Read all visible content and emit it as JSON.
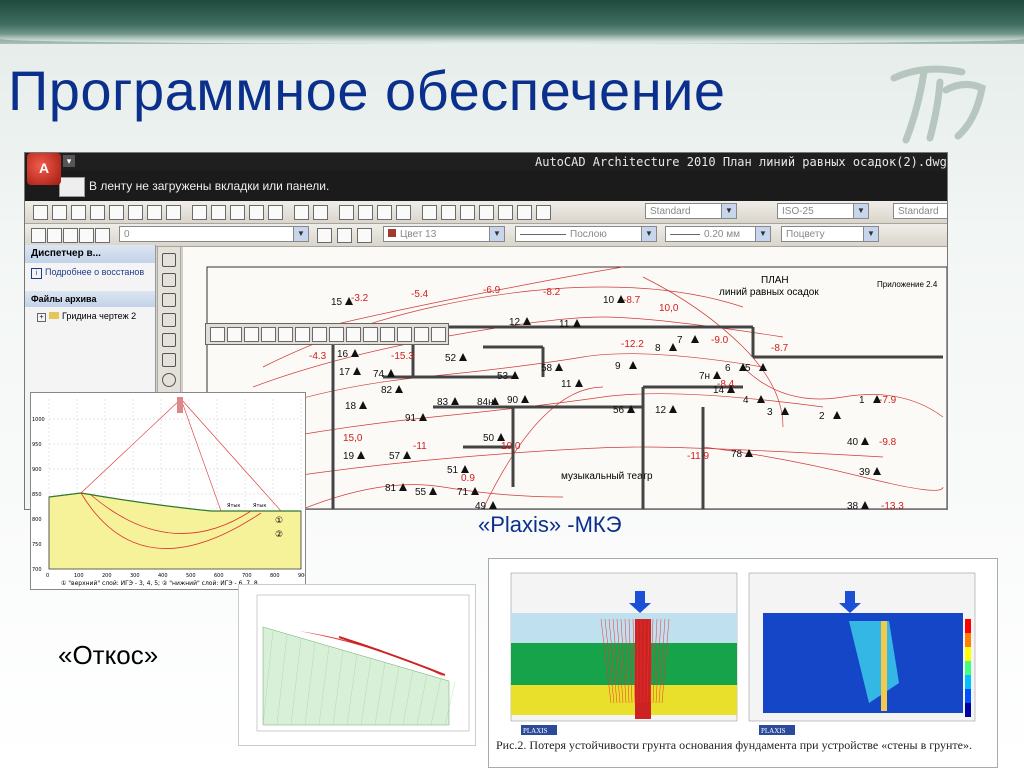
{
  "slide": {
    "title": "Программное обеспечение",
    "caption_plaxis": "«Plaxis» -МКЭ",
    "caption_otkos": "«Откос»",
    "accent": "#0b2f8c"
  },
  "autocad": {
    "window_title": "AutoCAD Architecture 2010    План линий равных осадок(2).dwg",
    "app_button": "A",
    "ribbon_message": "В ленту не загружены вкладки или панели.",
    "toolbar": {
      "combo_text_style": "Standard",
      "combo_dim_style": "ISO-25",
      "combo_table_style": "Standard"
    },
    "props": {
      "layer": "0",
      "color": "Цвет 13",
      "linetype": "Послою",
      "lineweight": "0.20 мм",
      "plotstyle": "Поцвету"
    },
    "panel": {
      "header": "Диспетчер в...",
      "link": "Подробнее о восстанов",
      "section": "Файлы архива",
      "item": "Гридина чертеж 2"
    },
    "drawing": {
      "plan_title_1": "ПЛАН",
      "plan_title_2": "линий равных осадок",
      "appendix": "Приложение 2.4",
      "theatre": "музыкальный театр",
      "labels": [
        {
          "t": "15"
        },
        {
          "t": "-3.2"
        },
        {
          "t": "-5.4"
        },
        {
          "t": "-6.9"
        },
        {
          "t": "-8.2"
        },
        {
          "t": "10"
        },
        {
          "t": "-8.7"
        },
        {
          "t": "10,0"
        },
        {
          "t": "12"
        },
        {
          "t": "11"
        },
        {
          "t": "16"
        },
        {
          "t": "-4.3"
        },
        {
          "t": "-15.3"
        },
        {
          "t": "52"
        },
        {
          "t": "-12.2"
        },
        {
          "t": "8"
        },
        {
          "t": "7"
        },
        {
          "t": "-9.0"
        },
        {
          "t": "-8.7"
        },
        {
          "t": "17"
        },
        {
          "t": "74"
        },
        {
          "t": "58"
        },
        {
          "t": "9"
        },
        {
          "t": "53"
        },
        {
          "t": "6"
        },
        {
          "t": "5"
        },
        {
          "t": "7н"
        },
        {
          "t": "-8.4"
        },
        {
          "t": "11"
        },
        {
          "t": "82"
        },
        {
          "t": "14"
        },
        {
          "t": "18"
        },
        {
          "t": "83"
        },
        {
          "t": "84н"
        },
        {
          "t": "90"
        },
        {
          "t": "56"
        },
        {
          "t": "12"
        },
        {
          "t": "4"
        },
        {
          "t": "3"
        },
        {
          "t": "2"
        },
        {
          "t": "1"
        },
        {
          "t": "-7.9"
        },
        {
          "t": "91"
        },
        {
          "t": "15,0"
        },
        {
          "t": "50"
        },
        {
          "t": "-11"
        },
        {
          "t": "10,0"
        },
        {
          "t": "40"
        },
        {
          "t": "-9.8"
        },
        {
          "t": "19"
        },
        {
          "t": "57"
        },
        {
          "t": "-11.9"
        },
        {
          "t": "78"
        },
        {
          "t": "51"
        },
        {
          "t": "0.9"
        },
        {
          "t": "39"
        },
        {
          "t": "81"
        },
        {
          "t": "55"
        },
        {
          "t": "71"
        },
        {
          "t": "49"
        },
        {
          "t": "38"
        },
        {
          "t": "-13.3"
        }
      ]
    }
  },
  "otkos_chart": {
    "y_ticks": [
      "1000",
      "950",
      "900",
      "850",
      "800",
      "750",
      "700"
    ],
    "x_ticks": [
      "0",
      "100",
      "200",
      "300",
      "400",
      "500",
      "600",
      "700",
      "800",
      "900"
    ],
    "labels": [
      "Ятык",
      "Ятык"
    ],
    "markers": [
      "①",
      "②"
    ],
    "footer": "① \"верхний\" слой: ИГЭ - 3, 4, 5;   ② \"нижний\" слой: ИГЭ - 6, 7, 8"
  },
  "plaxis_figure": {
    "logo_left": "PLAXIS",
    "logo_right": "PLAXIS",
    "caption": "Рис.2. Потеря устойчивости грунта основания фундамента при устройстве «стены в грунте»."
  }
}
